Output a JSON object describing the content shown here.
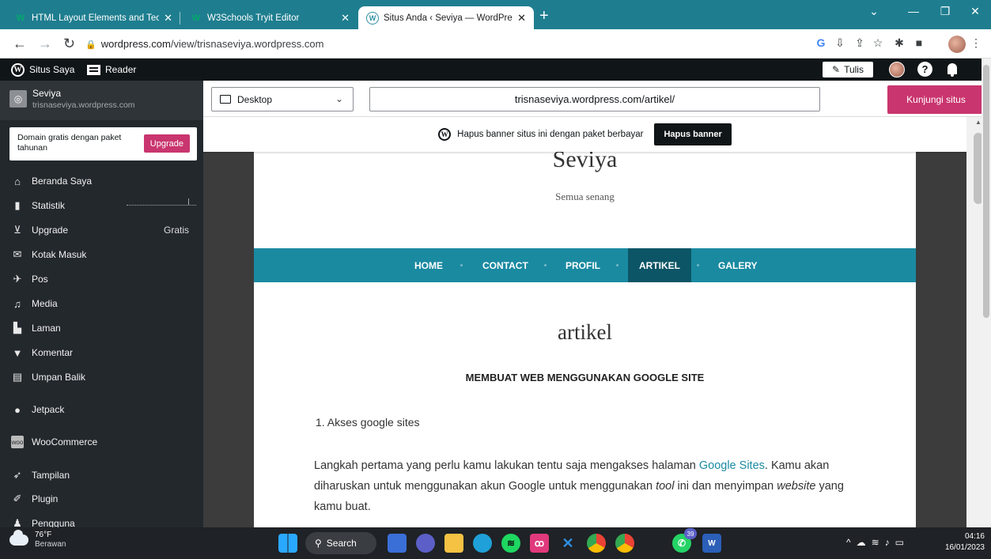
{
  "browser": {
    "tabs": [
      {
        "label": "HTML Layout Elements and Techn",
        "favicon": "w3schools-icon"
      },
      {
        "label": "W3Schools Tryit Editor",
        "favicon": "w3schools-icon"
      },
      {
        "label": "Situs Anda ‹ Seviya — WordPress",
        "favicon": "wordpress-icon",
        "active": true
      }
    ],
    "address": {
      "host": "wordpress.com",
      "path": "/view/trisnaseviya.wordpress.com"
    }
  },
  "adminbar": {
    "my_site": "Situs Saya",
    "reader": "Reader",
    "write": "Tulis"
  },
  "sidebar": {
    "site_name": "Seviya",
    "site_url": "trisnaseviya.wordpress.com",
    "promo_text": "Domain gratis dengan paket tahunan",
    "promo_button": "Upgrade",
    "items": [
      {
        "label": "Beranda Saya",
        "icon": "home-icon"
      },
      {
        "label": "Statistik",
        "icon": "stats-icon"
      },
      {
        "label": "Upgrade",
        "icon": "cart-icon",
        "badge": "Gratis"
      },
      {
        "label": "Kotak Masuk",
        "icon": "mail-icon"
      },
      {
        "label": "Pos",
        "icon": "pin-icon"
      },
      {
        "label": "Media",
        "icon": "media-icon"
      },
      {
        "label": "Laman",
        "icon": "page-icon"
      },
      {
        "label": "Komentar",
        "icon": "comment-icon"
      },
      {
        "label": "Umpan Balik",
        "icon": "feedback-icon"
      },
      {
        "label": "Jetpack",
        "icon": "jetpack-icon"
      },
      {
        "label": "WooCommerce",
        "icon": "woocommerce-icon"
      },
      {
        "label": "Tampilan",
        "icon": "appearance-icon"
      },
      {
        "label": "Plugin",
        "icon": "plugin-icon"
      },
      {
        "label": "Pengguna",
        "icon": "users-icon"
      }
    ]
  },
  "viewport": {
    "device": "Desktop",
    "url": "trisnaseviya.wordpress.com/artikel/",
    "visit_button": "Kunjungi situs"
  },
  "banner": {
    "text": "Hapus banner situs ini dengan paket berbayar",
    "button": "Hapus banner"
  },
  "site": {
    "title": "Seviya",
    "tagline": "Semua senang",
    "menu": [
      "HOME",
      "CONTACT",
      "PROFIL",
      "ARTIKEL",
      "GALERY"
    ],
    "current_menu": "ARTIKEL",
    "page_heading": "artikel",
    "article_heading": "MEMBUAT WEB MENGGUNAKAN GOOGLE SITE",
    "list_item": "1. Akses google sites",
    "para_1": "Langkah pertama yang perlu kamu lakukan tentu saja mengakses halaman ",
    "para_link": "Google Sites",
    "para_2": ". Kamu akan diharuskan untuk menggunakan akun Google untuk menggunakan ",
    "para_em1": "tool",
    "para_3": " ini dan menyimpan ",
    "para_em2": "website",
    "para_4": " yang kamu buat."
  },
  "taskbar": {
    "temp": "76°F",
    "weather": "Berawan",
    "search": "Search",
    "badge": "39",
    "time": "04:16",
    "date": "16/01/2023"
  },
  "colors": {
    "tab_strip": "#1e7e8f",
    "admin_bar": "#101517",
    "sidebar": "#23282d",
    "accent_pink": "#c9356e",
    "menu_bar": "#1a8aa1",
    "menu_current": "#0b5566"
  }
}
